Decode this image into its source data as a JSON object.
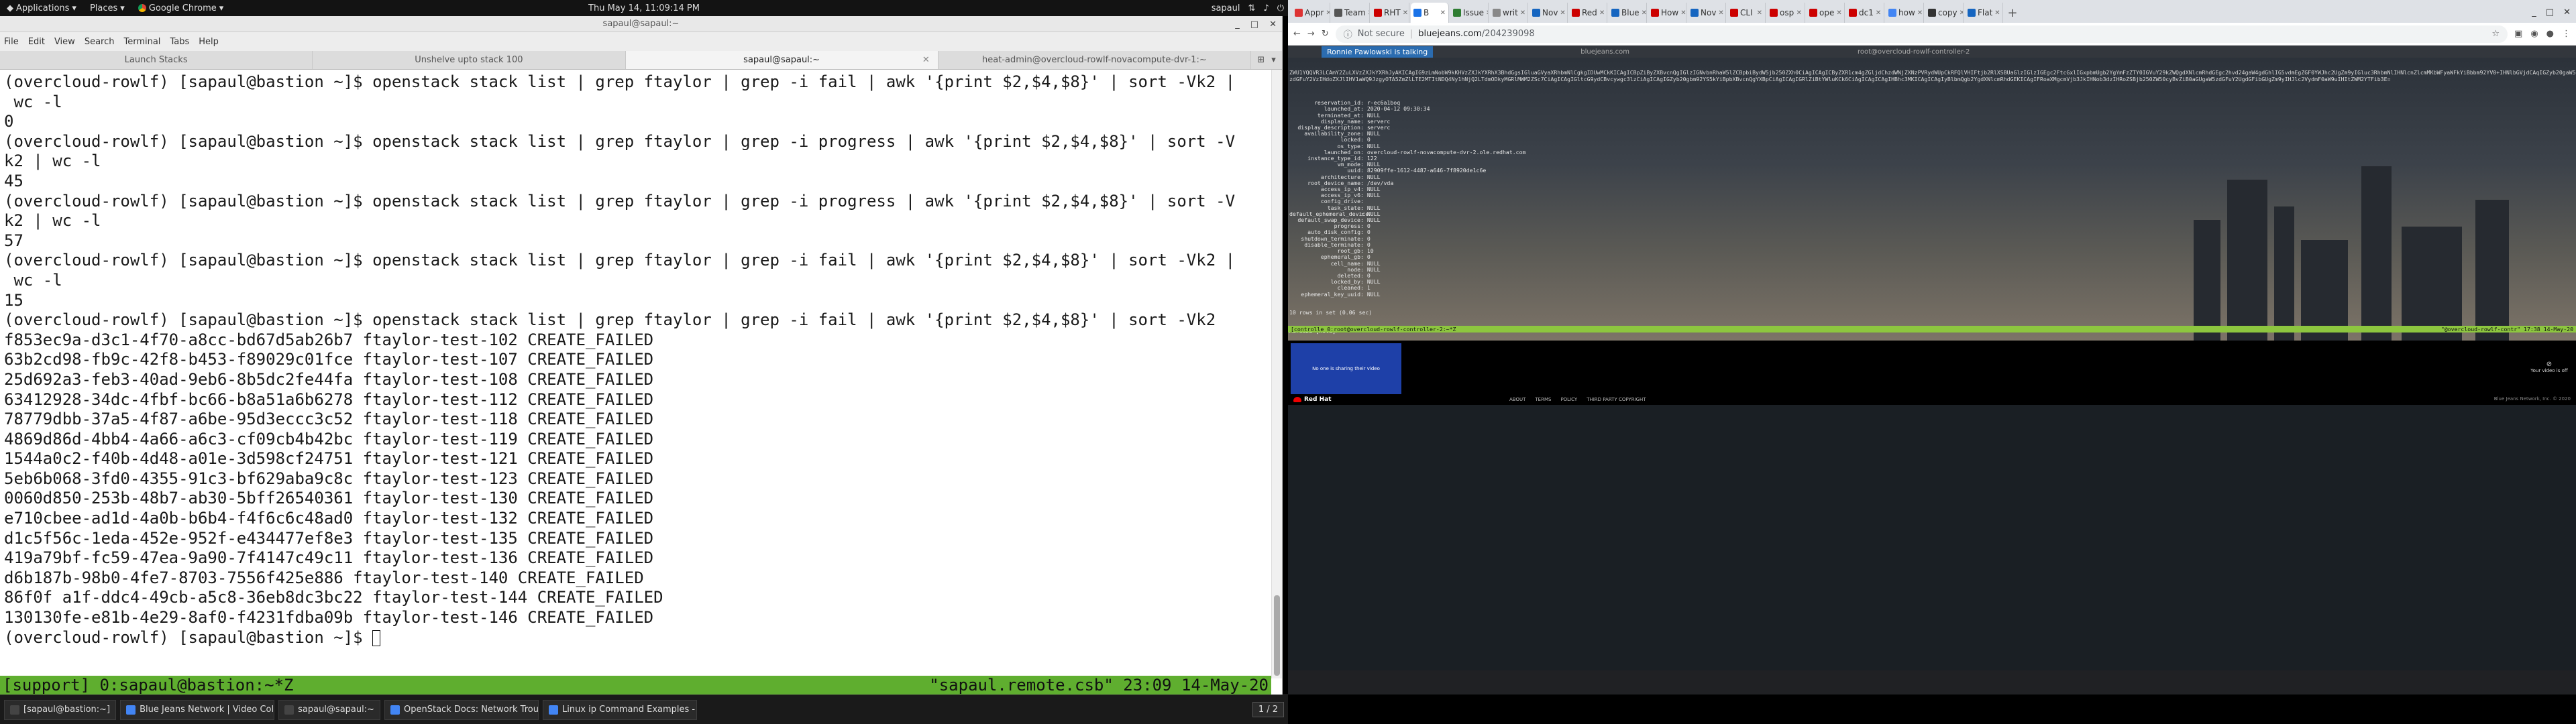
{
  "topbar": {
    "applications": "Applications",
    "places": "Places",
    "app": "Google Chrome",
    "clock": "Thu May 14, 11:09:14 PM",
    "tray_user": "sapaul"
  },
  "terminal": {
    "title": "sapaul@sapaul:~",
    "menu": [
      "File",
      "Edit",
      "View",
      "Search",
      "Terminal",
      "Tabs",
      "Help"
    ],
    "tabs": [
      "Launch Stacks",
      "Unshelve upto stack 100",
      "sapaul@sapaul:~",
      "heat-admin@overcloud-rowlf-novacompute-dvr-1:~"
    ],
    "lines": [
      "(overcloud-rowlf) [sapaul@bastion ~]$ openstack stack list | grep ftaylor | grep -i fail | awk '{print $2,$4,$8}' | sort -Vk2 |",
      " wc -l",
      "0",
      "(overcloud-rowlf) [sapaul@bastion ~]$ openstack stack list | grep ftaylor | grep -i progress | awk '{print $2,$4,$8}' | sort -V",
      "k2 | wc -l",
      "45",
      "(overcloud-rowlf) [sapaul@bastion ~]$ openstack stack list | grep ftaylor | grep -i progress | awk '{print $2,$4,$8}' | sort -V",
      "k2 | wc -l",
      "57",
      "(overcloud-rowlf) [sapaul@bastion ~]$ openstack stack list | grep ftaylor | grep -i fail | awk '{print $2,$4,$8}' | sort -Vk2 |",
      " wc -l",
      "15",
      "(overcloud-rowlf) [sapaul@bastion ~]$ openstack stack list | grep ftaylor | grep -i fail | awk '{print $2,$4,$8}' | sort -Vk2",
      "f853ec9a-d3c1-4f70-a8cc-bd67d5ab26b7 ftaylor-test-102 CREATE_FAILED",
      "63b2cd98-fb9c-42f8-b453-f89029c01fce ftaylor-test-107 CREATE_FAILED",
      "25d692a3-feb3-40ad-9eb6-8b5dc2fe44fa ftaylor-test-108 CREATE_FAILED",
      "63412928-34dc-4fbf-bc66-b8a51a6b6278 ftaylor-test-112 CREATE_FAILED",
      "78779dbb-37a5-4f87-a6be-95d3eccc3c52 ftaylor-test-118 CREATE_FAILED",
      "4869d86d-4bb4-4a66-a6c3-cf09cb4b42bc ftaylor-test-119 CREATE_FAILED",
      "1544a0c2-f40b-4d48-a01e-3d598cf24751 ftaylor-test-121 CREATE_FAILED",
      "5eb6b068-3fd0-4355-91c3-bf629aba9c8c ftaylor-test-123 CREATE_FAILED",
      "0060d850-253b-48b7-ab30-5bff26540361 ftaylor-test-130 CREATE_FAILED",
      "e710cbee-ad1d-4a0b-b6b4-f4f6c6c48ad0 ftaylor-test-132 CREATE_FAILED",
      "d1c5f56c-1eda-452e-952f-e434477ef8e3 ftaylor-test-135 CREATE_FAILED",
      "419a79bf-fc59-47ea-9a90-7f4147c49c11 ftaylor-test-136 CREATE_FAILED",
      "d6b187b-98b0-4fe7-8703-7556f425e886 ftaylor-test-140 CREATE_FAILED",
      "86f0f a1f-ddc4-49cb-a5c8-36eb8dc3bc22 ftaylor-test-144 CREATE_FAILED",
      "130130fe-e81b-4e29-8af0-f4231fdba09b ftaylor-test-146 CREATE_FAILED",
      "(overcloud-rowlf) [sapaul@bastion ~]$ "
    ],
    "status_left": "[support] 0:sapaul@bastion:~*Z",
    "status_right": "\"sapaul.remote.csb\" 23:09 14-May-20"
  },
  "chrome": {
    "tabs": [
      {
        "label": "Appr",
        "color": "#d33"
      },
      {
        "label": "Team",
        "color": "#555"
      },
      {
        "label": "RHT",
        "color": "#c00"
      },
      {
        "label": "B",
        "color": "#1a73e8",
        "active": true
      },
      {
        "label": "Issue",
        "color": "#2e7d32"
      },
      {
        "label": "writ",
        "color": "#888"
      },
      {
        "label": "Nov",
        "color": "#1565c0"
      },
      {
        "label": "Red",
        "color": "#c00"
      },
      {
        "label": "Blue",
        "color": "#1565c0"
      },
      {
        "label": "How",
        "color": "#c00"
      },
      {
        "label": "Nov",
        "color": "#1565c0"
      },
      {
        "label": "CLI",
        "color": "#c00"
      },
      {
        "label": "osp",
        "color": "#c00"
      },
      {
        "label": "ope",
        "color": "#c00"
      },
      {
        "label": "dc1",
        "color": "#c00"
      },
      {
        "label": "how",
        "color": "#4285f4"
      },
      {
        "label": "copy",
        "color": "#333"
      },
      {
        "label": "Flat",
        "color": "#1565c0"
      }
    ],
    "not_secure": "Not secure",
    "url_host": "bluejeans.com",
    "url_path": "/204239098"
  },
  "bluejeans": {
    "talking_badge": "Ronnie Pawlowski is talking",
    "inner_tabs": [
      "bluejeans.com",
      "root@overcloud-rowlf-controller-2"
    ],
    "blob": "ZWU1YQQVR3LCAmY2ZuLXVzZXJkYXRhJyAKICAgIG9zLmNobW9kKHVzZXJkYXRhX3BhdGgsIGluaGVyaXRhbmNlCgkgIDUwMCkKICAgICBpZiByZXBvcnQgIGlzIGNvbnRhaW5lZCBpbiBydW5jb250ZXh0CiAgICAgICByZXR1cm4gZGljdChzdWNjZXNzPVRydWUpCkRFQlVHIFtjb2RlXSBUaGlzIGlzIGEgc2FtcGxlIGxpbmUgb2YgYmFzZTY0IGVuY29kZWQgdXNlcmRhdGEgc2hvd24gaW4gdGhlIG5vdmEgZGF0YWJhc2UgZm9yIGluc3RhbmNlIHNlcnZlcmMKbWFyaWFkYiBbbm92YV0+IHNlbGVjdCAqIGZyb20gaW5zdGFuY2VzIHdoZXJlIHV1aWQ9JzgyOTA5ZmZlLTE2MTItNDQ4Ny1hNjQ2LTdmODkyMGRlMWM2ZSc7CiAgICAgIGltcG9ydCBvcywgc3lzCiAgICAgIGZyb20gbm92YS5kYiBpbXBvcnQgYXBpCiAgICAgIGRlZiBtYWluKCk6CiAgICAgICAgIHBhc3MKICAgICAgIyBlbmQgb2YgdXNlcmRhdGEKICAgIFRoaXMgcmVjb3JkIHNob3dzIHRoZSBjb250ZW50cyBvZiB0aGUgaW5zdGFuY2UgdGFibGUgZm9yIHJlc2VydmF0aW9uIHItZWM2YTFib3E=",
    "record": [
      [
        "reservation_id",
        "r-ec6a1boq"
      ],
      [
        "launched_at",
        "2020-04-12 09:30:34"
      ],
      [
        "terminated_at",
        "NULL"
      ],
      [
        "display_name",
        "serverc"
      ],
      [
        "display_description",
        "serverc"
      ],
      [
        "availability_zone",
        "NULL"
      ],
      [
        "locked",
        "0"
      ],
      [
        "os_type",
        "NULL"
      ],
      [
        "launched_on",
        "overcloud-rowlf-novacompute-dvr-2.ole.redhat.com"
      ],
      [
        "instance_type_id",
        "122"
      ],
      [
        "vm_mode",
        "NULL"
      ],
      [
        "uuid",
        "82909ffe-1612-4487-a646-7f8920de1c6e"
      ],
      [
        "architecture",
        "NULL"
      ],
      [
        "root_device_name",
        "/dev/vda"
      ],
      [
        "access_ip_v4",
        "NULL"
      ],
      [
        "access_ip_v6",
        "NULL"
      ],
      [
        "config_drive",
        ""
      ],
      [
        "task_state",
        "NULL"
      ],
      [
        "default_ephemeral_device",
        "NULL"
      ],
      [
        "default_swap_device",
        "NULL"
      ],
      [
        "progress",
        "0"
      ],
      [
        "auto_disk_config",
        "0"
      ],
      [
        "shutdown_terminate",
        "0"
      ],
      [
        "disable_terminate",
        "0"
      ],
      [
        "root_gb",
        "10"
      ],
      [
        "ephemeral_gb",
        "0"
      ],
      [
        "cell_name",
        "NULL"
      ],
      [
        "node",
        "NULL"
      ],
      [
        "deleted",
        "0"
      ],
      [
        "locked_by",
        "NULL"
      ],
      [
        "cleaned",
        "1"
      ],
      [
        "ephemeral_key_uuid",
        "NULL"
      ]
    ],
    "rows_summary": "10 rows in set (0.06 sec)",
    "prompt": "MariaDB [nova]> ",
    "inner_status_left": "[controlle 0:root@overcloud-rowlf-controller-2:~*Z",
    "inner_status_right": "\"@overcloud-rowlf-contr\" 17:38 14-May-20",
    "self_view_text": "No one is sharing their video",
    "video_off_text": "Your video is off",
    "footer_links": [
      "ABOUT",
      "TERMS",
      "POLICY",
      "THIRD PARTY COPYRIGHT"
    ],
    "redhat": "Red Hat",
    "copyright": "Blue Jeans Network, Inc. © 2020"
  },
  "taskbar": {
    "items": [
      {
        "label": "[sapaul@bastion:~]",
        "color": "#444"
      },
      {
        "label": "Blue Jeans Network | Video Colla...",
        "color": "#4285f4"
      },
      {
        "label": "sapaul@sapaul:~",
        "color": "#444"
      },
      {
        "label": "OpenStack Docs: Network Troubl...",
        "color": "#4285f4"
      },
      {
        "label": "Linux ip Command Examples - nix...",
        "color": "#4285f4"
      }
    ],
    "pager": "1 / 2"
  }
}
